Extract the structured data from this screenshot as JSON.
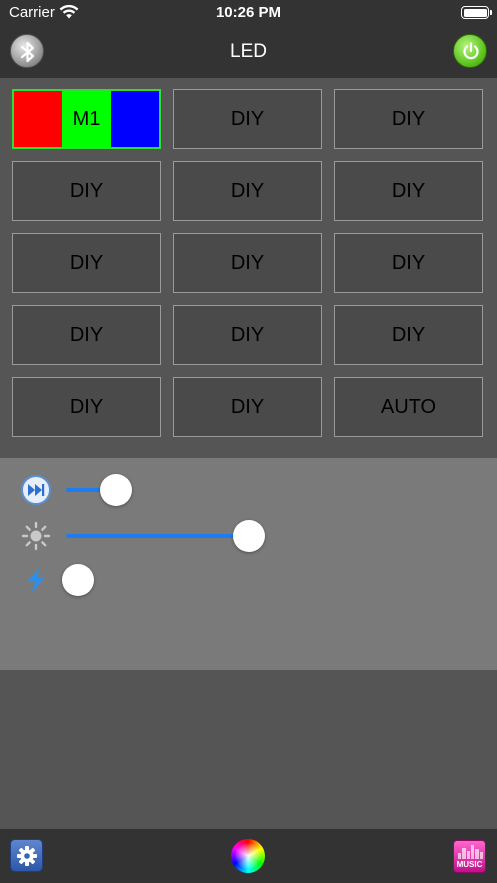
{
  "status_bar": {
    "carrier": "Carrier",
    "time": "10:26 PM"
  },
  "nav": {
    "title": "LED"
  },
  "modes": [
    {
      "label": "M1",
      "kind": "custom",
      "swatches": [
        "#ff0000",
        "#00ff00",
        "#0000ff"
      ]
    },
    {
      "label": "DIY"
    },
    {
      "label": "DIY"
    },
    {
      "label": "DIY"
    },
    {
      "label": "DIY"
    },
    {
      "label": "DIY"
    },
    {
      "label": "DIY"
    },
    {
      "label": "DIY"
    },
    {
      "label": "DIY"
    },
    {
      "label": "DIY"
    },
    {
      "label": "DIY"
    },
    {
      "label": "DIY"
    },
    {
      "label": "DIY"
    },
    {
      "label": "DIY"
    },
    {
      "label": "AUTO"
    }
  ],
  "sliders": [
    {
      "name": "speed",
      "icon": "fast-forward-icon",
      "value_fraction": 0.12
    },
    {
      "name": "brightness",
      "icon": "brightness-icon",
      "value_fraction": 0.44
    },
    {
      "name": "sensitivity",
      "icon": "lightning-icon",
      "value_fraction": 0.03
    }
  ],
  "toolbar": {
    "settings_icon": "gear-icon",
    "color_icon": "color-wheel-icon",
    "music_label": "MUSIC"
  },
  "colors": {
    "accent": "#1e7cf2",
    "selected_border": "#2ae22a",
    "power": "#59c21a"
  }
}
